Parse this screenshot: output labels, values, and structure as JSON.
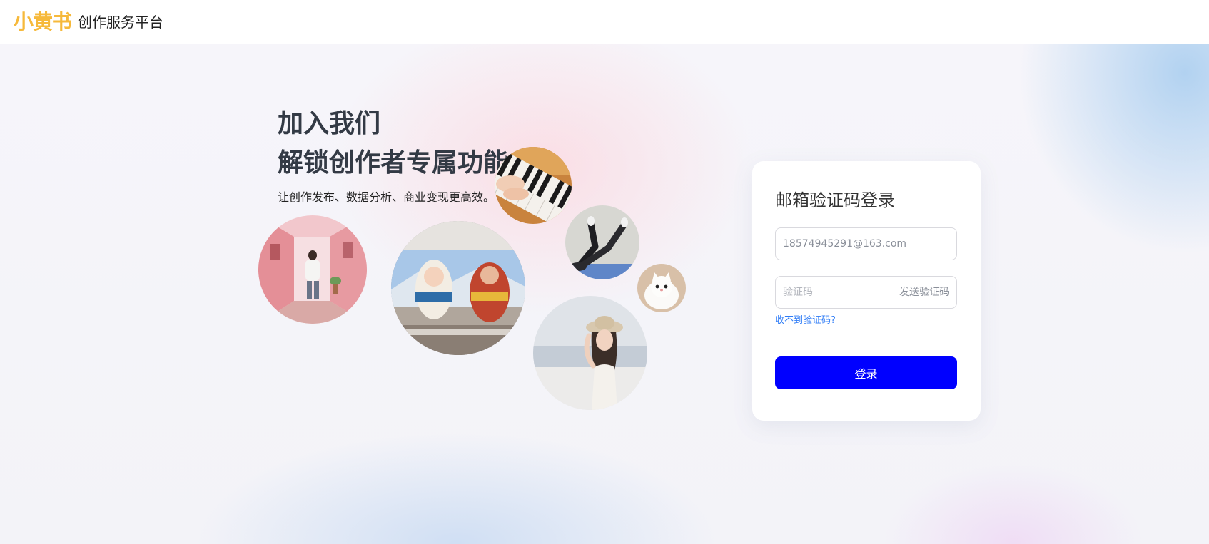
{
  "header": {
    "logo_text": "小黄书",
    "platform_name": "创作服务平台",
    "logo_color": "#f6b93b"
  },
  "hero": {
    "headline_line1": "加入我们",
    "headline_line2": "解锁创作者专属功能",
    "subtitle": "让创作发布、数据分析、商业变现更高效。",
    "images": [
      {
        "name": "piano-hands-photo"
      },
      {
        "name": "pink-alley-photo"
      },
      {
        "name": "friends-van-photo"
      },
      {
        "name": "yoga-legs-photo"
      },
      {
        "name": "white-cat-photo"
      },
      {
        "name": "beach-woman-photo"
      }
    ]
  },
  "login": {
    "title": "邮箱验证码登录",
    "email_value": "18574945291@163.com",
    "code_placeholder": "验证码",
    "send_code_label": "发送验证码",
    "no_code_link": "收不到验证码?",
    "submit_label": "登录",
    "accent_color": "#0000ff",
    "link_color": "#2f7cf6"
  }
}
